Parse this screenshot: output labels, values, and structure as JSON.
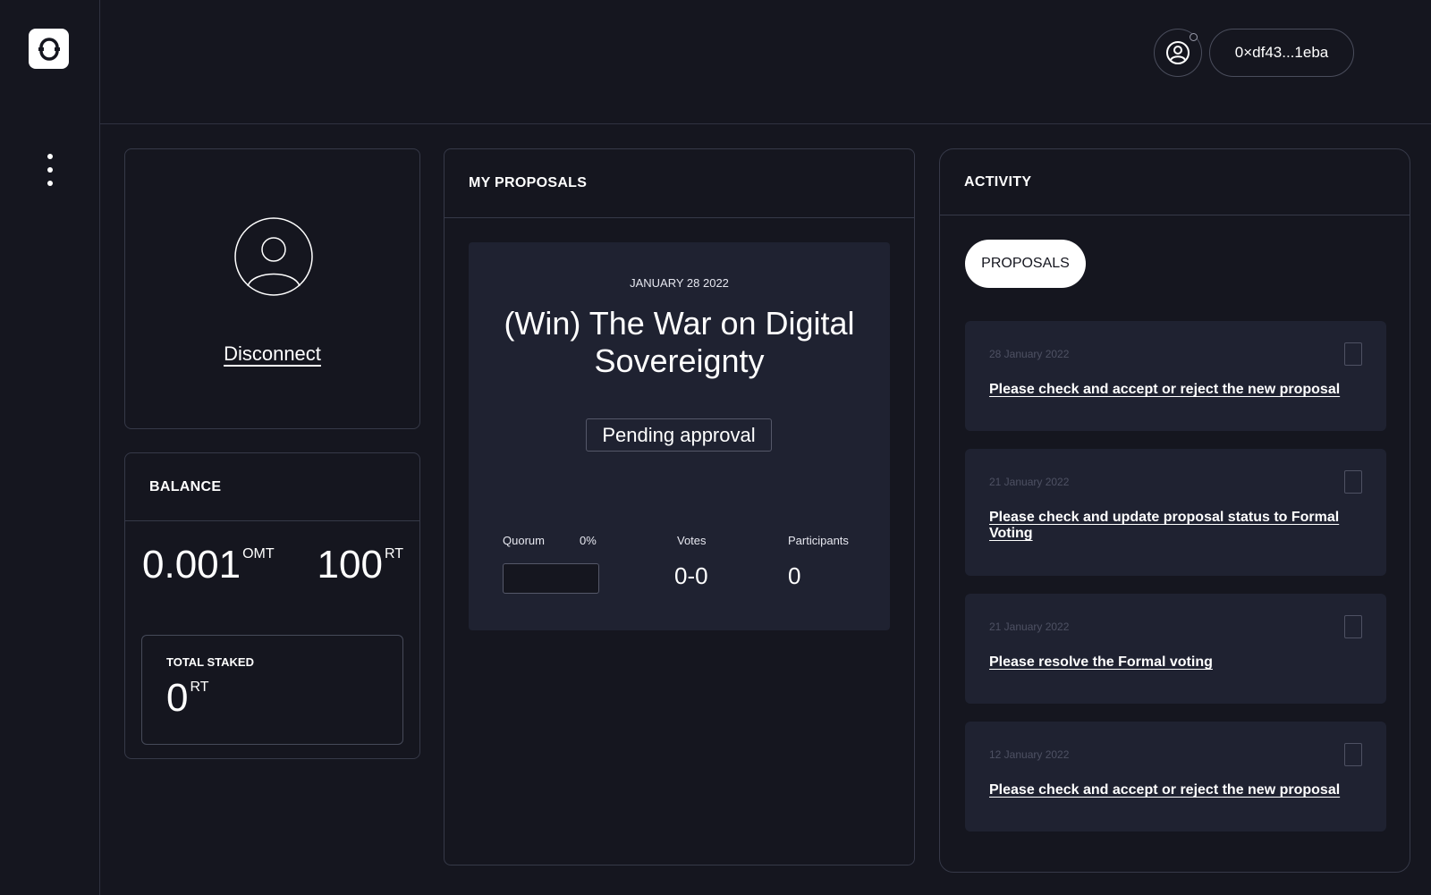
{
  "app": {
    "logo_icon": "sync-logo-icon",
    "menu_icon": "kebab-menu-icon"
  },
  "header": {
    "profile_icon": "user-circle-icon",
    "wallet_address": "0×df43...1eba"
  },
  "profile": {
    "avatar_icon": "user-avatar-icon",
    "disconnect_label": "Disconnect"
  },
  "balance": {
    "title": "BALANCE",
    "omt_value": "0.001",
    "omt_unit": "OMT",
    "rt_value": "100",
    "rt_unit": "RT",
    "staked_label": "TOTAL STAKED",
    "staked_value": "0",
    "staked_unit": "RT"
  },
  "my_proposals": {
    "title": "MY PROPOSALS",
    "items": [
      {
        "date": "JANUARY 28 2022",
        "title": "(Win) The War on Digital Sovereignty",
        "status": "Pending approval",
        "quorum_label": "Quorum",
        "quorum_percent": "0%",
        "quorum_fraction": 0,
        "votes_label": "Votes",
        "votes_value": "0-0",
        "participants_label": "Participants",
        "participants_value": "0"
      }
    ]
  },
  "activity": {
    "title": "ACTIVITY",
    "tab_label": "PROPOSALS",
    "items": [
      {
        "date": "28 January 2022",
        "text": "Please check and accept or reject the new proposal"
      },
      {
        "date": "21 January 2022",
        "text": "Please check and update proposal status to Formal Voting"
      },
      {
        "date": "21 January 2022",
        "text": "Please resolve the Formal voting"
      },
      {
        "date": "12 January 2022",
        "text": "Please check and accept or reject the new proposal"
      }
    ]
  }
}
